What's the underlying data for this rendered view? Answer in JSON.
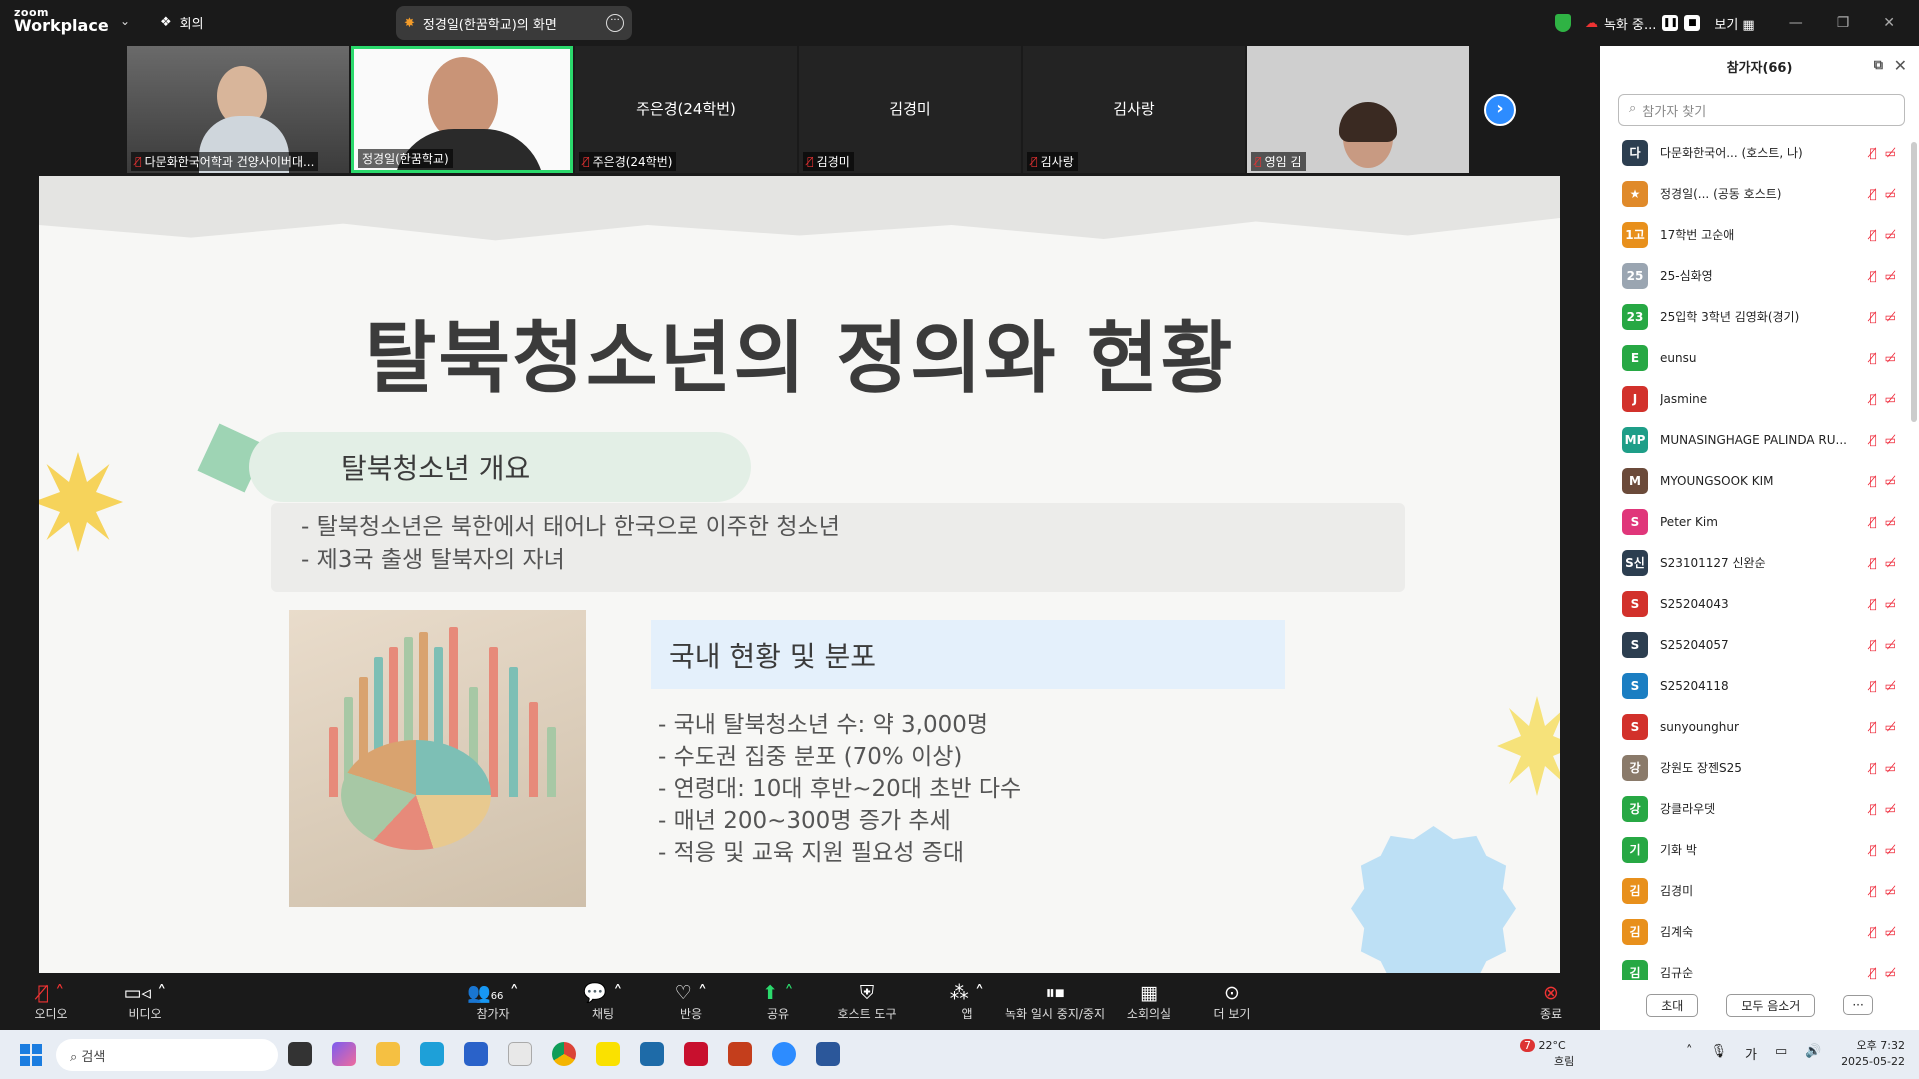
{
  "topbar": {
    "logo_small": "zoom",
    "logo_big": "Workplace",
    "meeting_label": "회의",
    "share_title": "정경일(한꿈학교)의 화면",
    "record_status": "녹화 중...",
    "view_label": "보기"
  },
  "video_strip": [
    {
      "name": "다문화한국어학과 건양사이버대...",
      "center": ""
    },
    {
      "name": "정경일(한꿈학교)",
      "center": ""
    },
    {
      "name": "주은경(24학번)",
      "center": "주은경(24학번)"
    },
    {
      "name": "김경미",
      "center": "김경미"
    },
    {
      "name": "김사랑",
      "center": "김사랑"
    },
    {
      "name": "영임 김",
      "center": ""
    }
  ],
  "slide": {
    "title": "탈북청소년의 정의와 현황",
    "section1_title": "탈북청소년 개요",
    "section1_items": [
      "탈북청소년은 북한에서 태어나 한국으로 이주한 청소년",
      "제3국 출생 탈북자의 자녀"
    ],
    "section2_title": "국내 현황 및 분포",
    "section2_items": [
      "- 국내 탈북청소년 수: 약 3,000명",
      "- 수도권 집중 분포 (70% 이상)",
      "- 연령대: 10대 후반~20대 초반 다수",
      "- 매년 200~300명 증가 추세",
      "- 적응 및 교육 지원 필요성 증대"
    ]
  },
  "participants_panel": {
    "title": "참가자(66)",
    "search_placeholder": "참가자 찾기",
    "invite_label": "초대",
    "mute_all_label": "모두 음소거",
    "more_label": "···",
    "participants": [
      {
        "avatar": "다",
        "color": "#2c3e50",
        "name": "다문화한국어...",
        "role": "(호스트, 나)"
      },
      {
        "avatar": "★",
        "color": "#e08a2a",
        "name": "정경일(...",
        "role": "(공동 호스트)"
      },
      {
        "avatar": "1고",
        "color": "#e8901c",
        "name": "17학번 고순애",
        "role": ""
      },
      {
        "avatar": "25",
        "color": "#9aa5b1",
        "name": "25-심화영",
        "role": ""
      },
      {
        "avatar": "23",
        "color": "#27a844",
        "name": "25입학 3학년 김영화(경기)",
        "role": ""
      },
      {
        "avatar": "E",
        "color": "#27a844",
        "name": "eunsu",
        "role": ""
      },
      {
        "avatar": "J",
        "color": "#d2312b",
        "name": "Jasmine",
        "role": ""
      },
      {
        "avatar": "MP",
        "color": "#1e9e88",
        "name": "MUNASINGHAGE PALINDA RU...",
        "role": ""
      },
      {
        "avatar": "M",
        "color": "#6b4a3a",
        "name": "MYOUNGSOOK KIM",
        "role": ""
      },
      {
        "avatar": "S",
        "color": "#e0367a",
        "name": "Peter Kim",
        "role": ""
      },
      {
        "avatar": "S신",
        "color": "#2c3e50",
        "name": "S23101127 신완순",
        "role": ""
      },
      {
        "avatar": "S",
        "color": "#d2312b",
        "name": "S25204043",
        "role": ""
      },
      {
        "avatar": "S",
        "color": "#2c3e50",
        "name": "S25204057",
        "role": ""
      },
      {
        "avatar": "S",
        "color": "#1b7ec2",
        "name": "S25204118",
        "role": ""
      },
      {
        "avatar": "S",
        "color": "#d2312b",
        "name": "sunyounghur",
        "role": ""
      },
      {
        "avatar": "강",
        "color": "#8a7a6a",
        "name": "강원도 장젠S25",
        "role": ""
      },
      {
        "avatar": "강",
        "color": "#27a844",
        "name": "강클라우뎃",
        "role": ""
      },
      {
        "avatar": "기",
        "color": "#27a844",
        "name": "기화 박",
        "role": ""
      },
      {
        "avatar": "김",
        "color": "#e8901c",
        "name": "김경미",
        "role": ""
      },
      {
        "avatar": "김",
        "color": "#e8901c",
        "name": "김계숙",
        "role": ""
      },
      {
        "avatar": "김",
        "color": "#27a844",
        "name": "김규순",
        "role": ""
      }
    ]
  },
  "toolbar": {
    "audio": "오디오",
    "video": "비디오",
    "participants": "참가자",
    "participants_count": "66",
    "chat": "채팅",
    "react": "반응",
    "share": "공유",
    "host_tools": "호스트 도구",
    "apps": "앱",
    "record_pause": "녹화 일시 중지/중지",
    "breakout": "소회의실",
    "more": "더 보기",
    "end": "종료"
  },
  "taskbar": {
    "search": "검색",
    "temperature": "22°C",
    "weather": "흐림",
    "weather_badge": "7",
    "ime": "가",
    "time": "오후 7:32",
    "date": "2025-05-22"
  },
  "colors": {
    "accent": "#2d8cff",
    "active_speaker": "#2bd96c",
    "end": "#e23"
  }
}
